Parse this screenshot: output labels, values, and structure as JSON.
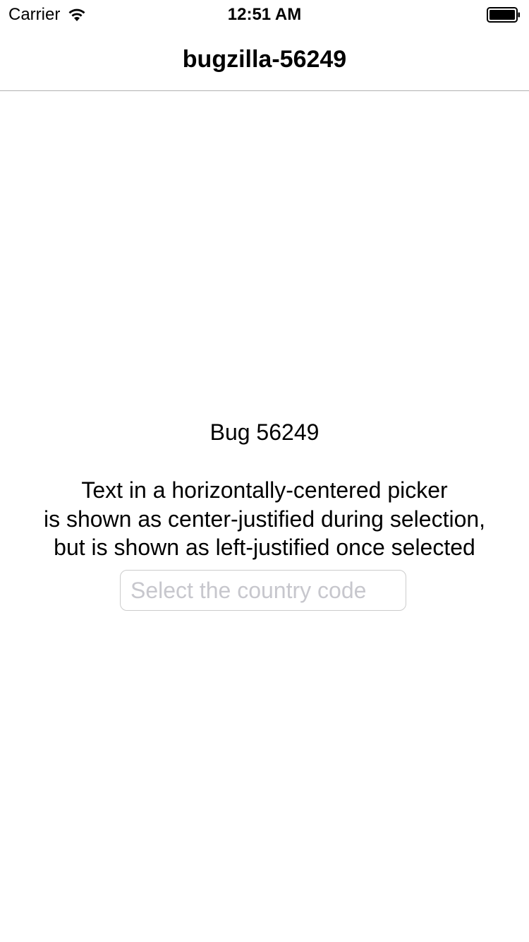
{
  "status_bar": {
    "carrier": "Carrier",
    "time": "12:51 AM",
    "icons": [
      "wifi-icon",
      "battery-icon"
    ]
  },
  "nav": {
    "title": "bugzilla-56249"
  },
  "content": {
    "bug_title": "Bug 56249",
    "description_lines": [
      "Text in a horizontally-centered picker",
      "is shown as center-justified during selection,",
      "but is shown as left-justified once selected"
    ],
    "picker": {
      "value": "",
      "placeholder": "Select the country code"
    }
  },
  "colors": {
    "background": "#ffffff",
    "text": "#000000",
    "placeholder": "#c7c7cd",
    "separator": "#b2b2b2",
    "field_border": "#cccccc"
  }
}
